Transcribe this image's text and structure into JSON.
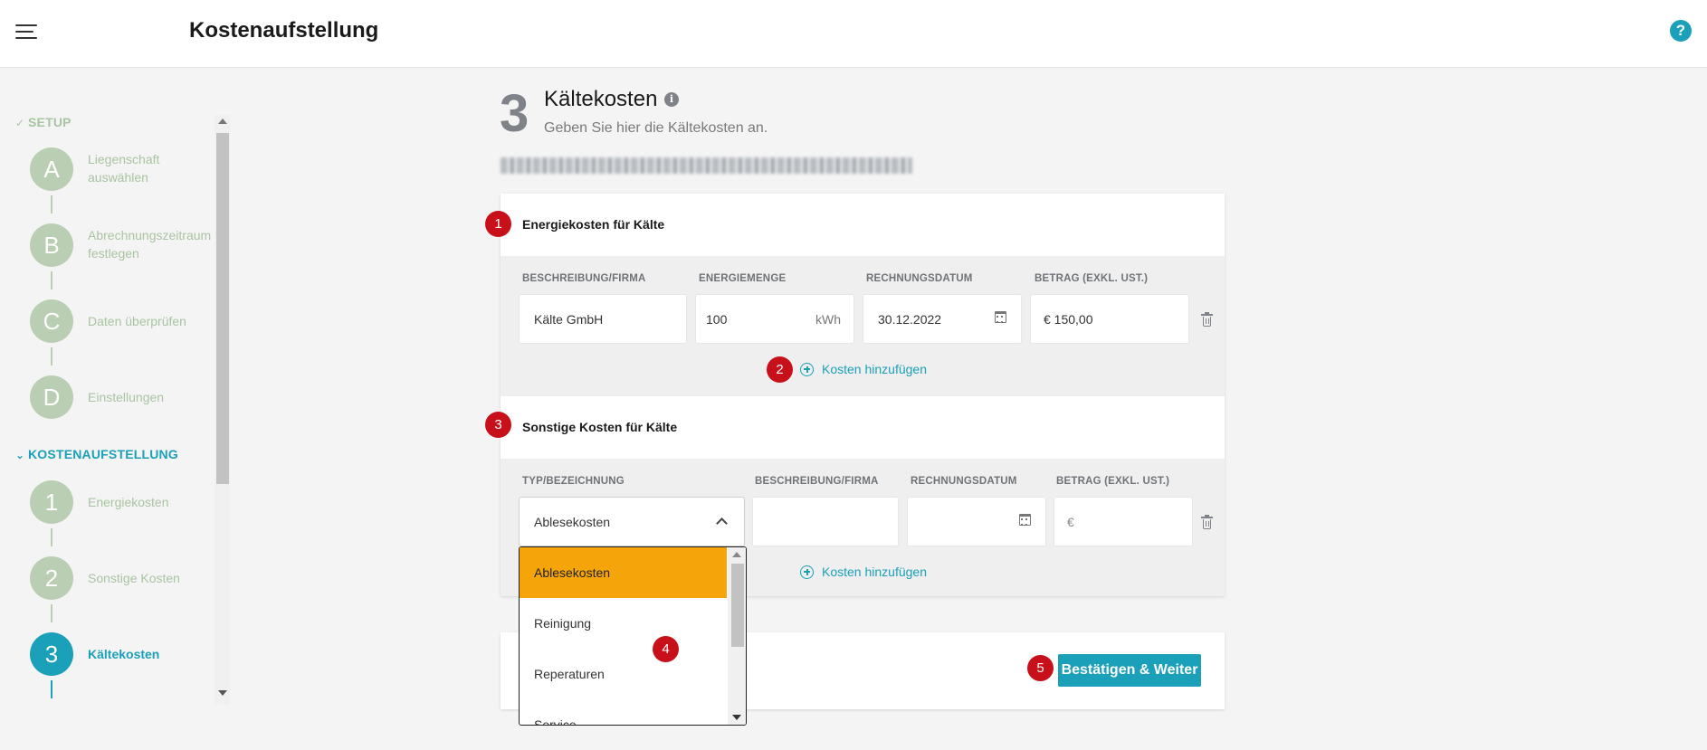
{
  "header": {
    "title": "Kostenaufstellung",
    "help_label": "?"
  },
  "sidebar": {
    "setup_label": "SETUP",
    "setup_mark": "✓",
    "setup_steps": [
      {
        "badge": "A",
        "label_line1": "Liegenschaft",
        "label_line2": "auswählen"
      },
      {
        "badge": "B",
        "label_line1": "Abrechnungszeitraum",
        "label_line2": "festlegen"
      },
      {
        "badge": "C",
        "label_line1": "Daten überprüfen",
        "label_line2": ""
      },
      {
        "badge": "D",
        "label_line1": "Einstellungen",
        "label_line2": ""
      }
    ],
    "kosten_label": "KOSTENAUFSTELLUNG",
    "kosten_mark": "⌄",
    "kosten_steps": [
      {
        "badge": "1",
        "label": "Energiekosten"
      },
      {
        "badge": "2",
        "label": "Sonstige Kosten"
      },
      {
        "badge": "3",
        "label": "Kältekosten"
      }
    ]
  },
  "main": {
    "step_number": "3",
    "title": "Kältekosten",
    "info_icon": "i",
    "subtitle": "Geben Sie hier die Kältekosten an.",
    "energy": {
      "heading": "Energiekosten für Kälte",
      "columns": [
        "BESCHREIBUNG/FIRMA",
        "ENERGIEMENGE",
        "RECHNUNGSDATUM",
        "BETRAG (EXKL. UST.)"
      ],
      "row": {
        "description": "Kälte GmbH",
        "amount": "100",
        "unit": "kWh",
        "date": "30.12.2022",
        "price": "€ 150,00"
      },
      "add_label": "Kosten hinzufügen"
    },
    "other": {
      "heading": "Sonstige Kosten für Kälte",
      "columns": [
        "TYP/BEZEICHNUNG",
        "BESCHREIBUNG/FIRMA",
        "RECHNUNGSDATUM",
        "BETRAG (EXKL. UST.)"
      ],
      "row": {
        "type": "Ablesekosten",
        "description": "",
        "date": "",
        "price": "€"
      },
      "add_label": "Kosten hinzufügen"
    },
    "confirm_label": "Bestätigen & Weiter"
  },
  "dropdown": {
    "options": [
      "Ablesekosten",
      "Reinigung",
      "Reperaturen",
      "Service"
    ],
    "selected": "Ablesekosten"
  },
  "annotations": [
    "1",
    "2",
    "3",
    "4",
    "5"
  ],
  "colors": {
    "accent": "#1aa0b8",
    "inactive_step": "#b9ceb3",
    "selected_option": "#f5a50a",
    "annotation": "#c8101a"
  }
}
